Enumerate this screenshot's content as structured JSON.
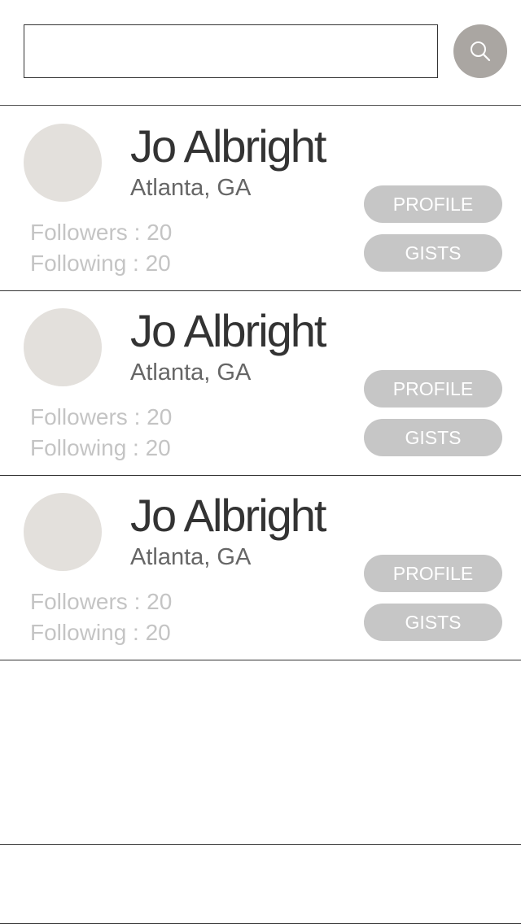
{
  "search": {
    "value": "",
    "placeholder": "",
    "icon": "search-icon",
    "button_color": "#aaa6a2"
  },
  "users": [
    {
      "name": "Jo Albright",
      "location": "Atlanta, GA",
      "followers": "Followers : 20",
      "following": "Following : 20",
      "profile_label": "PROFILE",
      "gists_label": "GISTS"
    },
    {
      "name": "Jo Albright",
      "location": "Atlanta, GA",
      "followers": "Followers : 20",
      "following": "Following : 20",
      "profile_label": "PROFILE",
      "gists_label": "GISTS"
    },
    {
      "name": "Jo Albright",
      "location": "Atlanta, GA",
      "followers": "Followers : 20",
      "following": "Following : 20",
      "profile_label": "PROFILE",
      "gists_label": "GISTS"
    }
  ],
  "colors": {
    "avatar_placeholder": "#e3e0dc",
    "button_background": "#c6c6c6",
    "button_text": "#ffffff",
    "stat_text": "#c4c4c4"
  }
}
